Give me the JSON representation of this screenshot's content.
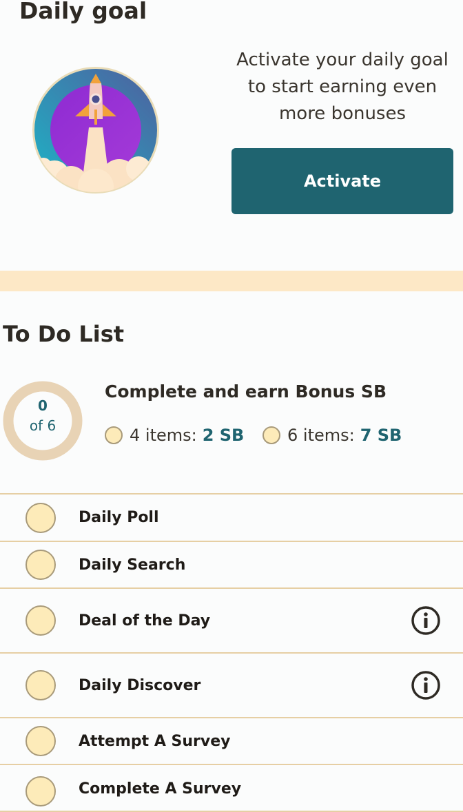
{
  "daily_goal": {
    "title": "Daily goal",
    "description": "Activate your daily goal to start earning even more bonuses",
    "activate_label": "Activate",
    "badge_icon": "rocket-launch-icon"
  },
  "todo": {
    "title": "To Do List",
    "progress": {
      "completed": "0",
      "of_label": "of 6",
      "value": 0,
      "total": 6
    },
    "bonus_title": "Complete and earn Bonus SB",
    "tiers": [
      {
        "label": "4 items:",
        "reward": "2 SB"
      },
      {
        "label": "6 items:",
        "reward": "7 SB"
      }
    ],
    "items": [
      {
        "label": "Daily Poll",
        "info": false
      },
      {
        "label": "Daily Search",
        "info": false
      },
      {
        "label": "Deal of the Day",
        "info": true
      },
      {
        "label": "Daily Discover",
        "info": true
      },
      {
        "label": "Attempt A Survey",
        "info": false
      },
      {
        "label": "Complete A Survey",
        "info": false
      }
    ]
  },
  "colors": {
    "accent": "#1f6470",
    "band": "#fde8c6",
    "check_fill": "#fdebb9",
    "divider": "#e6cfa4"
  }
}
